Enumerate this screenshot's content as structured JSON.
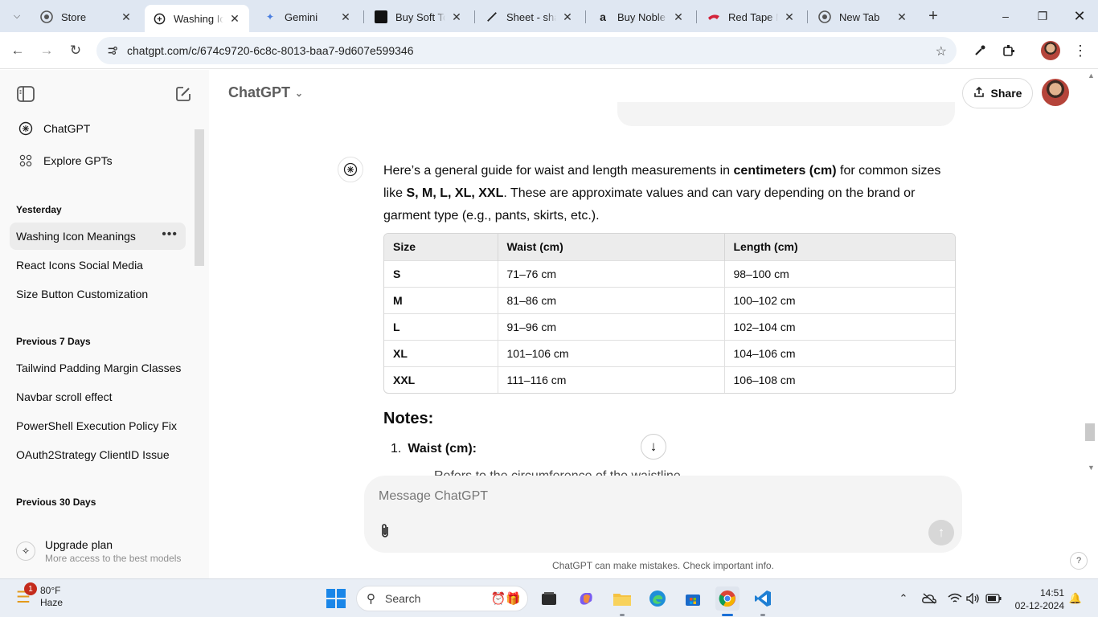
{
  "browser": {
    "tabs": [
      {
        "title": "Store",
        "icon": "chrome-store-icon"
      },
      {
        "title": "Washing Icon Meanings",
        "icon": "chatgpt-icon",
        "active": true
      },
      {
        "title": "Gemini",
        "icon": "gemini-icon"
      },
      {
        "title": "Buy Soft Touch",
        "icon": "site-icon"
      },
      {
        "title": "Sheet - shadcn",
        "icon": "pen-icon"
      },
      {
        "title": "Buy Noble Monks",
        "icon": "amazon-icon"
      },
      {
        "title": "Red Tape Men",
        "icon": "redtape-icon"
      },
      {
        "title": "New Tab",
        "icon": "chrome-icon"
      }
    ],
    "url": "chatgpt.com/c/674c9720-6c8c-8013-baa7-9d607e599346"
  },
  "sidebar": {
    "nav": [
      {
        "label": "ChatGPT",
        "icon": "chatgpt-logo-icon"
      },
      {
        "label": "Explore GPTs",
        "icon": "grid-icon"
      }
    ],
    "sections": [
      {
        "heading": "Yesterday",
        "items": [
          "Washing Icon Meanings",
          "React Icons Social Media",
          "Size Button Customization"
        ]
      },
      {
        "heading": "Previous 7 Days",
        "items": [
          "Tailwind Padding Margin Classes",
          "Navbar scroll effect",
          "PowerShell Execution Policy Fix",
          "OAuth2Strategy ClientID Issue"
        ]
      },
      {
        "heading": "Previous 30 Days",
        "items": []
      }
    ],
    "upgrade": {
      "title": "Upgrade plan",
      "subtitle": "More access to the best models"
    }
  },
  "header": {
    "model": "ChatGPT",
    "share_label": "Share"
  },
  "answer": {
    "p1": "Here’s a general guide for waist and length measurements in ",
    "p1_bold": "centimeters (cm)",
    "p1_b": " for common sizes like ",
    "p1_sizes": "S, M, L, XL, XXL",
    "p1_end": ". These are approximate values and can vary depending on the brand or garment type (e.g., pants, skirts, etc.).",
    "table": {
      "headers": [
        "Size",
        "Waist (cm)",
        "Length (cm)"
      ],
      "rows": [
        [
          "S",
          "71–76 cm",
          "98–100 cm"
        ],
        [
          "M",
          "81–86 cm",
          "100–102 cm"
        ],
        [
          "L",
          "91–96 cm",
          "102–104 cm"
        ],
        [
          "XL",
          "101–106 cm",
          "104–106 cm"
        ],
        [
          "XXL",
          "111–116 cm",
          "106–108 cm"
        ]
      ]
    },
    "notes_heading": "Notes:",
    "notes_item_num": "1.",
    "notes_item": "Waist (cm):",
    "notes_cut": "Refers to the circumference of the waistline"
  },
  "composer": {
    "placeholder": "Message ChatGPT",
    "disclaimer": "ChatGPT can make mistakes. Check important info.",
    "help": "?"
  },
  "taskbar": {
    "weather_temp": "80°F",
    "weather_desc": "Haze",
    "weather_badge": "1",
    "search": "Search",
    "time": "14:51",
    "date": "02-12-2024"
  }
}
